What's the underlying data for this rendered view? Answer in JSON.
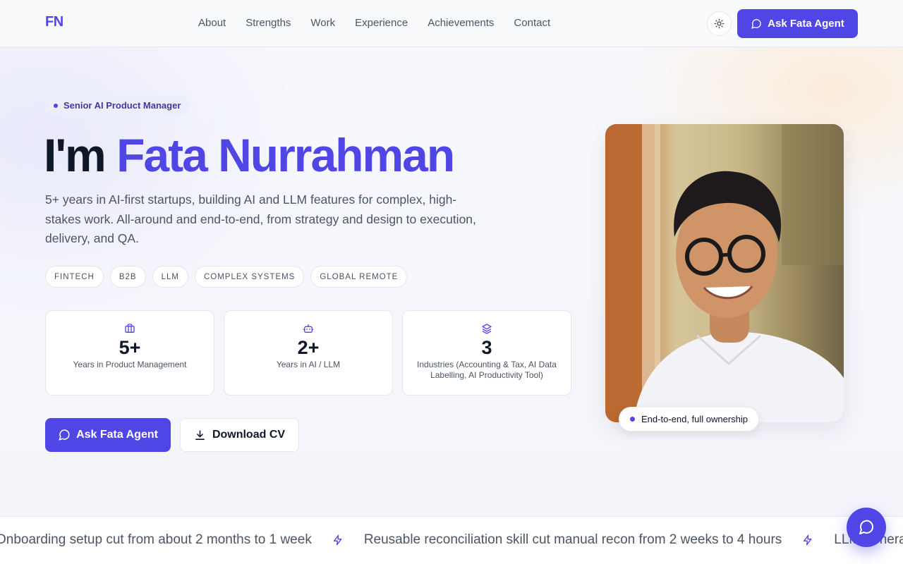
{
  "header": {
    "logo": "FN",
    "nav": [
      "About",
      "Strengths",
      "Work",
      "Experience",
      "Achievements",
      "Contact"
    ],
    "agent_button": "Ask Fata Agent"
  },
  "hero": {
    "badge": "Senior AI Product Manager",
    "title_prefix": "I'm ",
    "title_name": "Fata Nurrahman",
    "description": "5+ years in AI-first startups, building AI and LLM features for complex, high-stakes work. All-around and end-to-end, from strategy and design to execution, delivery, and QA.",
    "tags": [
      "FINTECH",
      "B2B",
      "LLM",
      "COMPLEX SYSTEMS",
      "GLOBAL REMOTE"
    ],
    "stats": [
      {
        "icon": "briefcase-icon",
        "value": "5+",
        "label": "Years in Product Management"
      },
      {
        "icon": "robot-icon",
        "value": "2+",
        "label": "Years in AI / LLM"
      },
      {
        "icon": "layers-icon",
        "value": "3",
        "label": "Industries (Accounting & Tax, AI Data Labelling, AI Productivity Tool)"
      }
    ],
    "primary_cta": "Ask Fata Agent",
    "secondary_cta": "Download CV",
    "photo_caption": "End-to-end, full ownership"
  },
  "ticker": {
    "items": [
      "Onboarding setup cut from about 2 months to 1 week",
      "Reusable reconciliation skill cut manual recon from 2 weeks to 4 hours",
      "LLM-genera"
    ]
  },
  "colors": {
    "accent": "#4f46e5",
    "text": "#0f172a",
    "muted": "#4b5563"
  }
}
